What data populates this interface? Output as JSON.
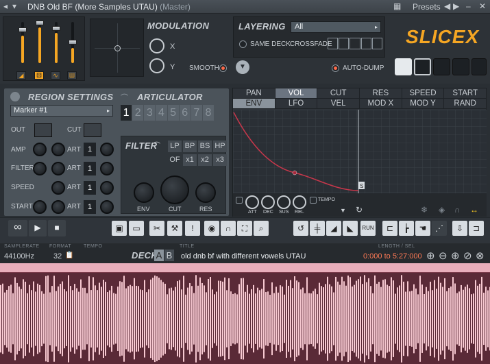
{
  "window": {
    "title": "DNB Old BF (More Samples UTAU)",
    "title_suffix": "(Master)",
    "presets_label": "Presets"
  },
  "modulation": {
    "title": "MODULATION",
    "x_label": "X",
    "y_label": "Y",
    "smooth_label": "SMOOTH"
  },
  "layering": {
    "title": "LAYERING",
    "select_value": "All",
    "same_deck_label": "SAME DECK",
    "crossfade_label": "CROSSFADE",
    "auto_dump_label": "AUTO-DUMP"
  },
  "brand": {
    "logo": "SLICEX",
    "accent": "#f5a623"
  },
  "region": {
    "title": "REGION SETTINGS",
    "marker": "Marker #1",
    "out_label": "OUT",
    "cut_label": "CUT",
    "amp_label": "AMP",
    "filter_label": "FILTER",
    "speed_label": "SPEED",
    "start_label": "START",
    "art_label": "ART",
    "art_values": [
      "1",
      "1",
      "1",
      "1"
    ]
  },
  "articulator": {
    "title": "ARTICULATOR",
    "numbers": [
      "1",
      "2",
      "3",
      "4",
      "5",
      "6",
      "7",
      "8"
    ]
  },
  "filter": {
    "title": "FILTER",
    "types": [
      "LP",
      "BP",
      "BS",
      "HP"
    ],
    "of_label": "OF",
    "multipliers": [
      "x1",
      "x2",
      "x3"
    ],
    "env_label": "ENV",
    "cut_label": "CUT",
    "res_label": "RES"
  },
  "env_tabs": {
    "row1": [
      "PAN",
      "VOL",
      "CUT",
      "RES",
      "SPEED",
      "START"
    ],
    "row2": [
      "ENV",
      "LFO",
      "VEL",
      "MOD X",
      "MOD Y",
      "RAND"
    ],
    "knobs": [
      "ATT",
      "DEC",
      "SUS",
      "REL"
    ],
    "tempo_label": "TEMPO",
    "point_label": "S"
  },
  "info": {
    "samplerate_label": "SAMPLERATE",
    "samplerate": "44100Hz",
    "format_label": "FORMAT",
    "format_value": "32",
    "tempo_label": "TEMPO",
    "title_label": "TITLE",
    "deck_label": "DECK",
    "deck_a": "A",
    "deck_b": "B",
    "sample_title": "old dnb bf with different vowels UTAU",
    "length_label": "LENGTH / SEL",
    "length_value": "0:000 to 5:27:000"
  }
}
